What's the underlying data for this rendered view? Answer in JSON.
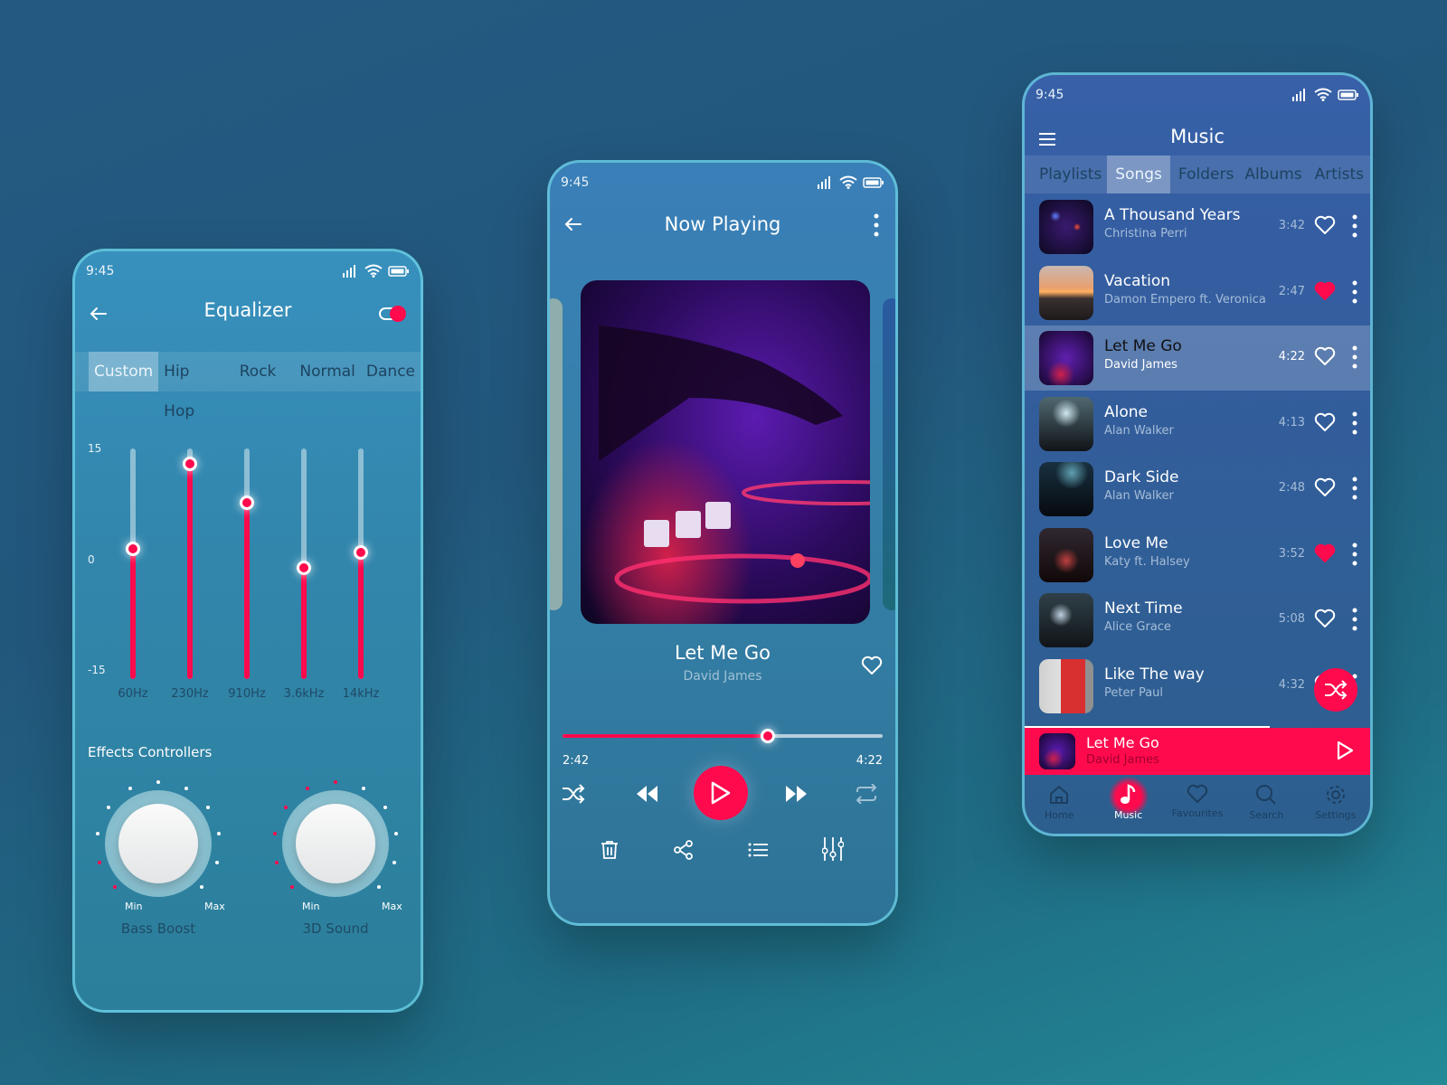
{
  "colors": {
    "accent": "#ff0a4d",
    "background": "#245a82"
  },
  "status_bar": {
    "time": "9:45"
  },
  "equalizer": {
    "title": "Equalizer",
    "enabled": true,
    "presets": [
      "Custom",
      "Hip Hop",
      "Rock",
      "Normal",
      "Dance"
    ],
    "active_preset": "Custom",
    "y_ticks": [
      "15",
      "0",
      "-15"
    ],
    "range_db": [
      -15,
      15
    ],
    "bands": [
      {
        "label": "60Hz",
        "value_db": 2
      },
      {
        "label": "230Hz",
        "value_db": 13
      },
      {
        "label": "910Hz",
        "value_db": 8
      },
      {
        "label": "3.6kHz",
        "value_db": -0.5
      },
      {
        "label": "14kHz",
        "value_db": 1.5
      }
    ],
    "effects_title": "Effects Controllers",
    "dials": [
      {
        "name": "Bass Boost",
        "min_label": "Min",
        "max_label": "Max",
        "active_steps": 2,
        "total_steps": 11
      },
      {
        "name": "3D Sound",
        "min_label": "Min",
        "max_label": "Max",
        "active_steps": 6,
        "total_steps": 11
      }
    ]
  },
  "now_playing": {
    "title": "Now Playing",
    "song": "Let Me Go",
    "artist": "David James",
    "elapsed": "2:42",
    "duration": "4:22",
    "progress": 0.64,
    "favorite": false
  },
  "music": {
    "title": "Music",
    "tabs": [
      "Playlists",
      "Songs",
      "Folders",
      "Albums",
      "Artists"
    ],
    "active_tab": "Songs",
    "songs": [
      {
        "title": "A Thousand Years",
        "artist": "Christina Perri",
        "duration": "3:42",
        "favorite": false,
        "selected": false
      },
      {
        "title": "Vacation",
        "artist": "Damon Empero ft. Veronica",
        "duration": "2:47",
        "favorite": true,
        "selected": false
      },
      {
        "title": "Let Me Go",
        "artist": "David James",
        "duration": "4:22",
        "favorite": false,
        "selected": true
      },
      {
        "title": "Alone",
        "artist": "Alan Walker",
        "duration": "4:13",
        "favorite": false,
        "selected": false
      },
      {
        "title": "Dark Side",
        "artist": "Alan Walker",
        "duration": "2:48",
        "favorite": false,
        "selected": false
      },
      {
        "title": "Love Me",
        "artist": "Katy ft. Halsey",
        "duration": "3:52",
        "favorite": true,
        "selected": false
      },
      {
        "title": "Next Time",
        "artist": "Alice Grace",
        "duration": "5:08",
        "favorite": false,
        "selected": false
      },
      {
        "title": "Like The way",
        "artist": "Peter Paul",
        "duration": "4:32",
        "favorite": false,
        "selected": false
      }
    ],
    "mini_player": {
      "song": "Let Me Go",
      "artist": "David James",
      "progress": 0.71
    },
    "nav": [
      {
        "label": "Home",
        "icon": "home-icon"
      },
      {
        "label": "Music",
        "icon": "music-note-icon"
      },
      {
        "label": "Favourites",
        "icon": "heart-icon"
      },
      {
        "label": "Search",
        "icon": "search-icon"
      },
      {
        "label": "Settings",
        "icon": "gear-icon"
      }
    ],
    "active_nav": "Music"
  }
}
